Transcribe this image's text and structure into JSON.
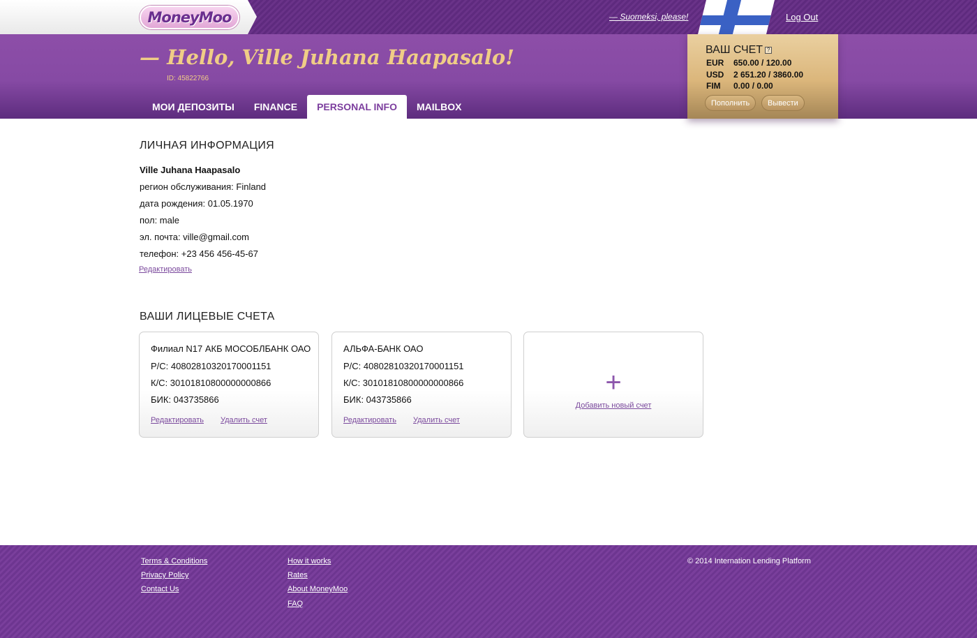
{
  "topbar": {
    "logo_text": "MoneyMoo",
    "language_link": "— Suomeksi, please!",
    "flag_icon": "finland-flag-icon",
    "logout": "Log Out"
  },
  "header": {
    "greeting": "— Hello, Ville Juhana Haapasalo!",
    "user_id": "ID: 45822766"
  },
  "nav": {
    "tabs": [
      {
        "label": "МОИ ДЕПОЗИТЫ",
        "active": false
      },
      {
        "label": "FINANCE",
        "active": false
      },
      {
        "label": "PERSONAL INFO",
        "active": true
      },
      {
        "label": "MAILBOX",
        "active": false
      }
    ]
  },
  "account": {
    "title": "ВАШ СЧЕТ",
    "help": "?",
    "balances": [
      {
        "currency": "EUR",
        "value": "650.00 / 120.00"
      },
      {
        "currency": "USD",
        "value": "2 651.20 / 3860.00"
      },
      {
        "currency": "FIM",
        "value": "0.00 / 0.00"
      }
    ],
    "deposit_button": "Пополнить",
    "withdraw_button": "Вывести"
  },
  "personal": {
    "title": "ЛИЧНАЯ ИНФОРМАЦИЯ",
    "name": "Ville Juhana Haapasalo",
    "lines": [
      "регион обслуживания: Finland",
      "дата рождения: 01.05.1970",
      "пол: male",
      "эл. почта: ville@gmail.com",
      "телефон: +23 456 456-45-67"
    ],
    "edit_link": "Редактировать"
  },
  "accounts": {
    "title": "ВАШИ ЛИЦЕВЫЕ СЧЕТА",
    "cards": [
      {
        "bank": "Филиал N17 АКБ МОСОБЛБАНК ОАО",
        "rs": "Р/С: 40802810320170001151",
        "ks": "К/С: 30101810800000000866",
        "bik": "БИК: 043735866",
        "edit": "Редактировать",
        "delete": "Удалить счет"
      },
      {
        "bank": "АЛЬФА-БАНК ОАО",
        "rs": "Р/С: 40802810320170001151",
        "ks": "К/С: 30101810800000000866",
        "bik": "БИК: 043735866",
        "edit": "Редактировать",
        "delete": "Удалить счет"
      }
    ],
    "add_icon": "+",
    "add_link": "Добавить новый счет"
  },
  "footer": {
    "col1": [
      "Terms & Conditions",
      "Privacy Policy",
      "Contact Us"
    ],
    "col2": [
      "How it works",
      "Rates",
      "About MoneyMoo",
      "FAQ"
    ],
    "copyright": "© 2014 Internation Lending Platform"
  }
}
